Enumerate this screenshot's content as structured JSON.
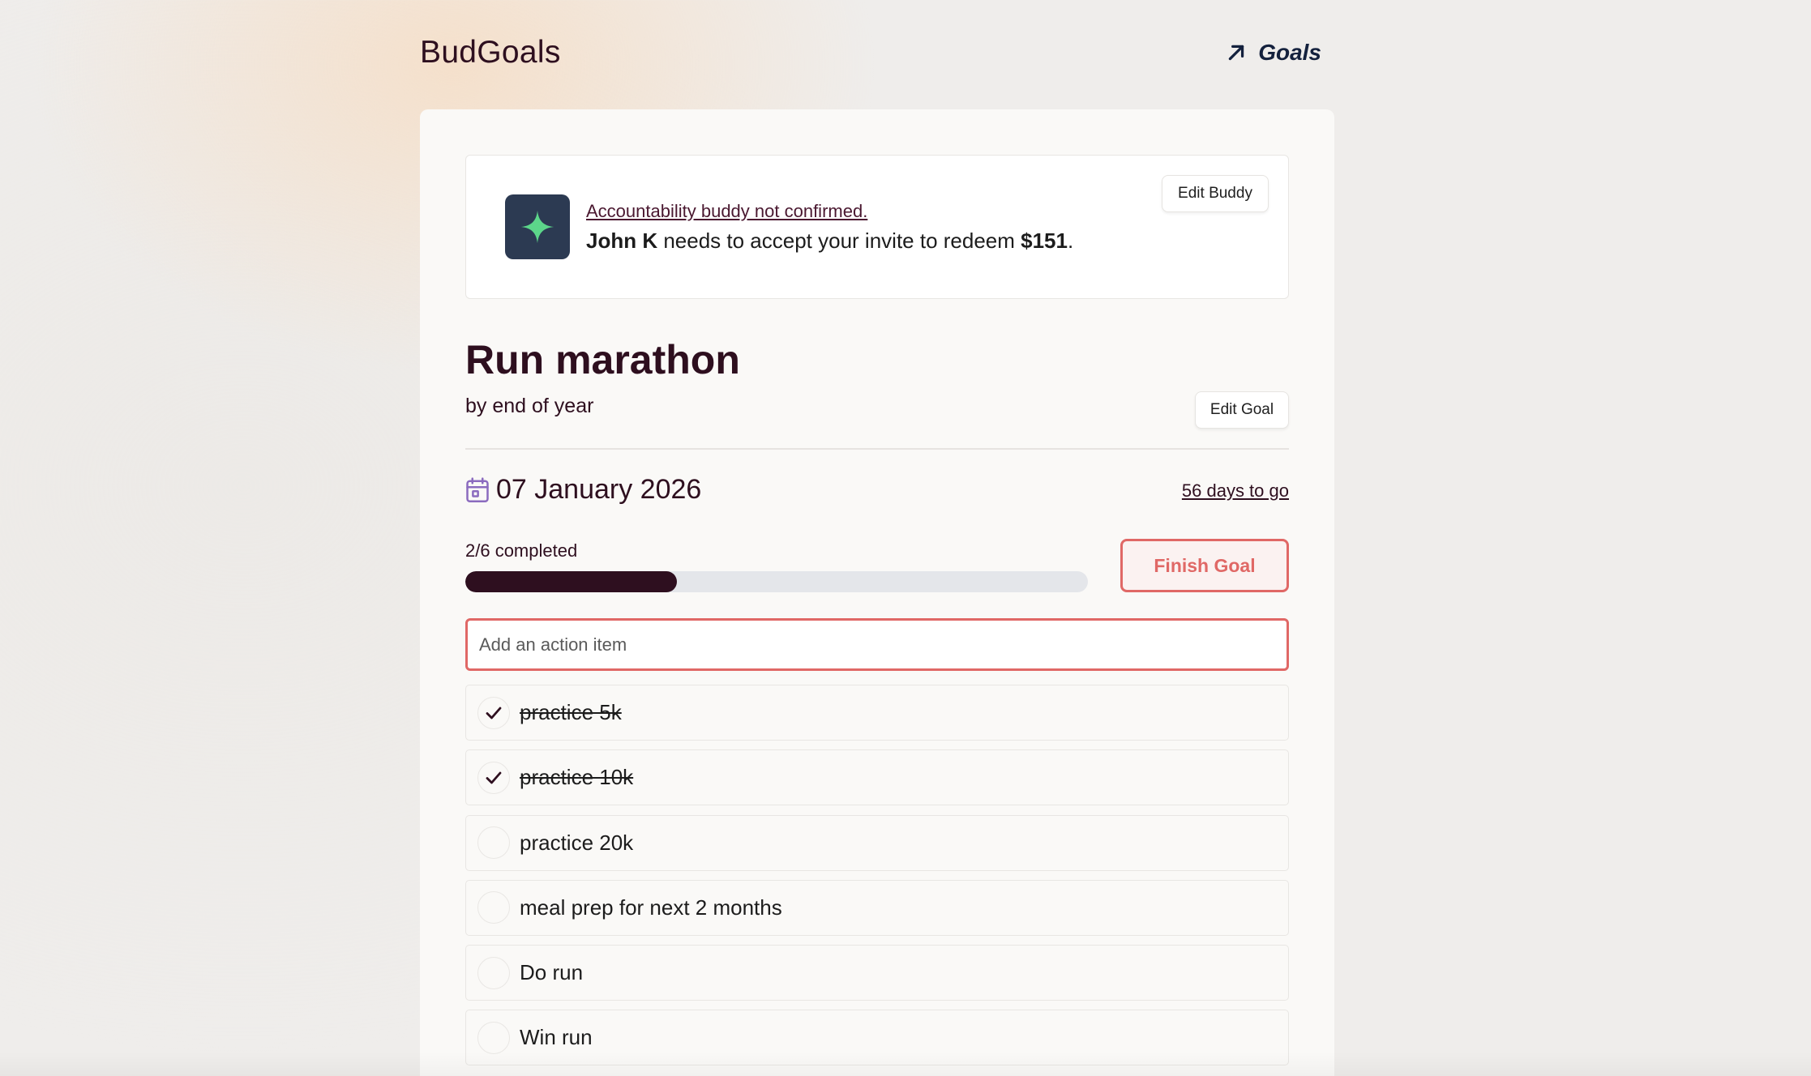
{
  "header": {
    "brand": "BudGoals",
    "nav_link": "Goals"
  },
  "buddy": {
    "status_link": "Accountability buddy not confirmed.",
    "buddy_name": "John K",
    "message_middle": " needs to accept your invite to redeem ",
    "amount": "$151",
    "message_end": ".",
    "edit_button": "Edit Buddy"
  },
  "goal": {
    "title": "Run marathon",
    "subtitle": "by end of year",
    "edit_button": "Edit Goal",
    "date": "07 January 2026",
    "days_left": "56 days to go",
    "progress_label": "2/6 completed",
    "progress_fraction": 0.34,
    "finish_button": "Finish Goal"
  },
  "action_input": {
    "placeholder": "Add an action item",
    "value": ""
  },
  "items": [
    {
      "label": "practice 5k",
      "done": true
    },
    {
      "label": "practice 10k",
      "done": true
    },
    {
      "label": "practice 20k",
      "done": false
    },
    {
      "label": "meal prep for next 2 months",
      "done": false
    },
    {
      "label": "Do run",
      "done": false
    },
    {
      "label": "Win run",
      "done": false
    }
  ],
  "colors": {
    "brand_dark": "#2e0f1f",
    "accent_red": "#e06866",
    "logo_bg": "#2c3a52",
    "logo_star": "#5cd68a",
    "calendar_icon": "#8b6bbf"
  },
  "icons": {
    "nav": "arrow-up-right-icon",
    "logo": "sparkle-star-icon",
    "date": "calendar-icon",
    "done": "checkmark-icon"
  }
}
